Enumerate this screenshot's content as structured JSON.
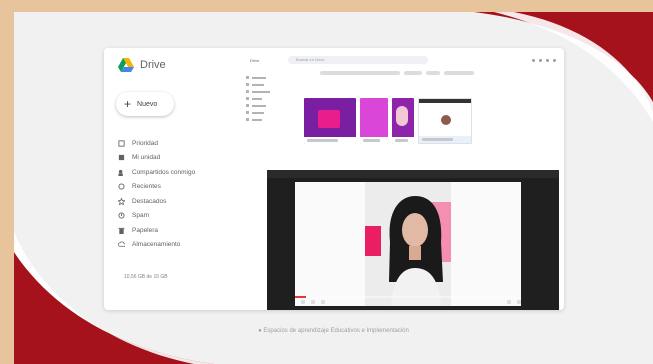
{
  "drive": {
    "brand": "Drive",
    "new_label": "Nuevo",
    "nav": [
      {
        "label": "Prioridad",
        "icon": "priority-icon"
      },
      {
        "label": "Mi unidad",
        "icon": "my-drive-icon"
      },
      {
        "label": "Compartidos conmigo",
        "icon": "shared-icon"
      },
      {
        "label": "Recientes",
        "icon": "clock-icon"
      },
      {
        "label": "Destacados",
        "icon": "star-icon"
      },
      {
        "label": "Spam",
        "icon": "spam-icon"
      },
      {
        "label": "Papelera",
        "icon": "trash-icon"
      },
      {
        "label": "Almacenamiento",
        "icon": "cloud-icon"
      }
    ],
    "storage": "10,56 GB de 15 GB"
  },
  "files": {
    "logo": "Drive",
    "search_placeholder": "Buscar en Drive"
  },
  "video": {
    "progress": 0.05
  },
  "caption": "● Espacios de aprendizaje Educativos e Implementación",
  "colors": {
    "frame": "#e8c49c",
    "accent_red": "#b71c1c",
    "drive_blue": "#4285f4",
    "drive_green": "#0f9d58",
    "drive_yellow": "#f4b400",
    "pink": "#e91e8c",
    "purple": "#7b1fa2"
  }
}
